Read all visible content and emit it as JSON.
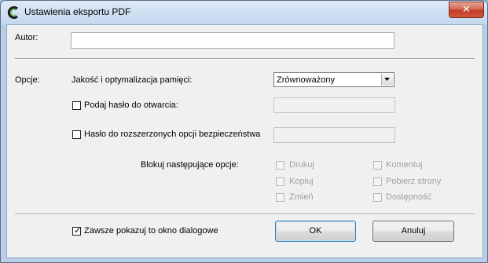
{
  "window": {
    "title": "Ustawienia eksportu PDF",
    "close_glyph": "✕"
  },
  "author": {
    "label": "Autor:",
    "value": ""
  },
  "options": {
    "label": "Opcje:",
    "quality": {
      "label": "Jakość i optymalizacja pamięci:",
      "selected": "Zrównoważony"
    },
    "open_password": {
      "label": "Podaj hasło do otwarcia:",
      "checked": false,
      "value": ""
    },
    "extended_password": {
      "label": "Hasło do rozszerzonych opcji bezpieczeństwa",
      "checked": false,
      "value": ""
    },
    "lock": {
      "label": "Blokuj następujące opcje:",
      "items": [
        "Drukuj",
        "Komentuj",
        "Kopiuj",
        "Pobierz strony",
        "Zmień",
        "Dostępność"
      ]
    }
  },
  "footer": {
    "always_show_label": "Zawsze pokazuj to okno dialogowe",
    "always_show_checked": true,
    "ok_label": "OK",
    "cancel_label": "Anuluj"
  },
  "colors": {
    "close_button": "#c23b24",
    "titlebar": "#c3d7ee",
    "client": "#f0f0f0"
  },
  "icons": {
    "app": "app-logo-icon",
    "check": "checkmark-icon",
    "dropdown": "chevron-down-icon"
  }
}
